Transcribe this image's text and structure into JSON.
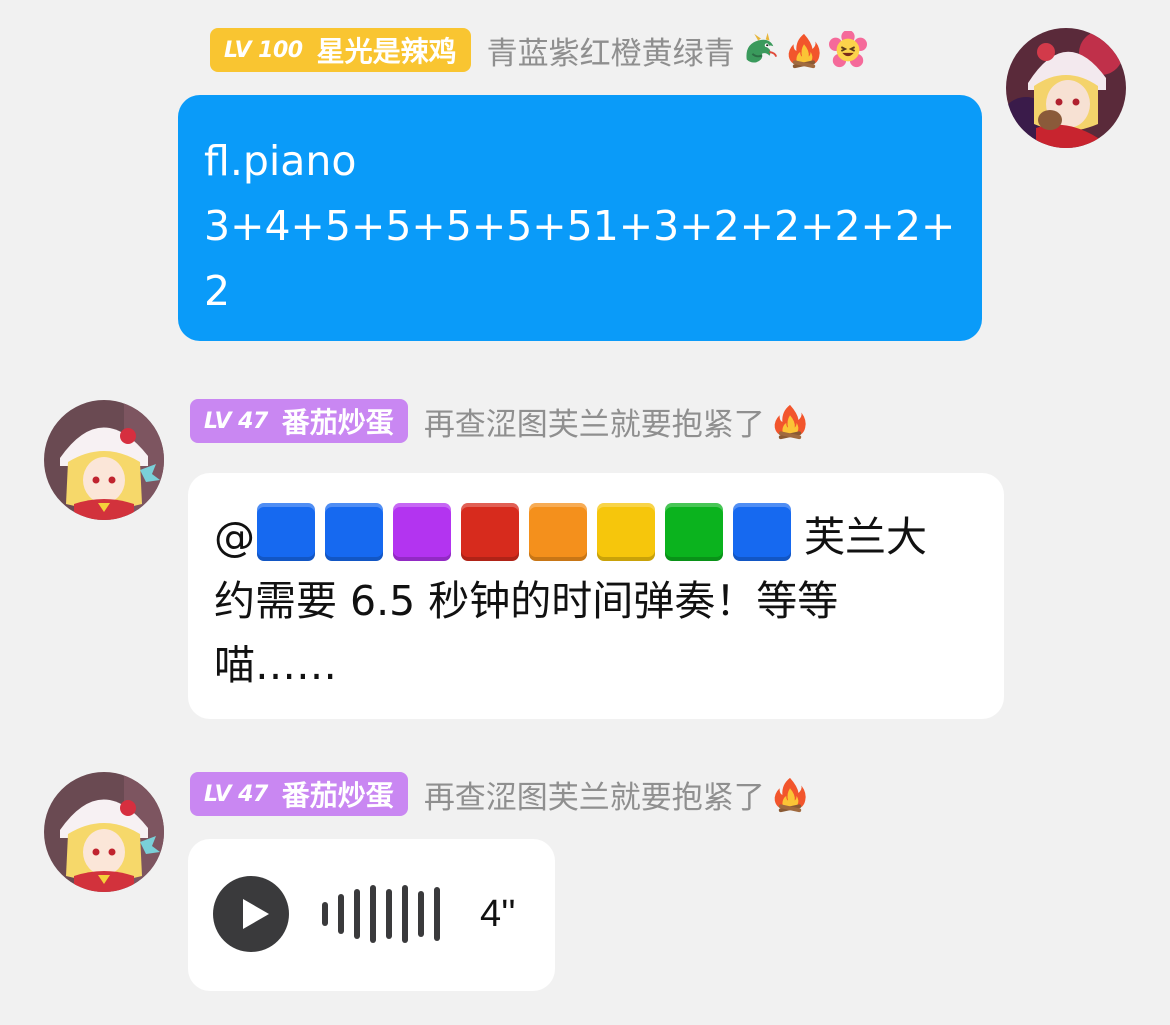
{
  "messages": {
    "me": {
      "level": "LV 100",
      "name": "星光是辣鸡",
      "title": "青蓝紫红橙黄绿青",
      "title_icons": [
        "dragon-icon",
        "fire-icon",
        "grinning-flower-icon"
      ],
      "text_lines": [
        "fl.piano",
        "3+4+5+5+5+5+51+3+2+2+2+2+",
        "2"
      ],
      "bubble_color": "#0a9bf9",
      "badge_color": "#f9c531"
    },
    "bot_reply": {
      "level": "LV 47",
      "name": "番茄炒蛋",
      "title": "再查涩图芙兰就要抱紧了",
      "title_icons": [
        "fire-icon"
      ],
      "mention_prefix": "@",
      "mention_squares": [
        "#1669f0",
        "#1669f0",
        "#b334f0",
        "#d72b1d",
        "#f4901c",
        "#f6c60c",
        "#0bb31e",
        "#1669f0"
      ],
      "text_line_1_tail": " 芙兰大",
      "text_line_2": "约需要 6.5 秒钟的时间弹奏！等等",
      "text_line_3": "喵……",
      "badge_color": "#c987f2"
    },
    "bot_voice": {
      "level": "LV 47",
      "name": "番茄炒蛋",
      "title": "再查涩图芙兰就要抱紧了",
      "title_icons": [
        "fire-icon"
      ],
      "duration": "4''",
      "badge_color": "#c987f2"
    }
  }
}
